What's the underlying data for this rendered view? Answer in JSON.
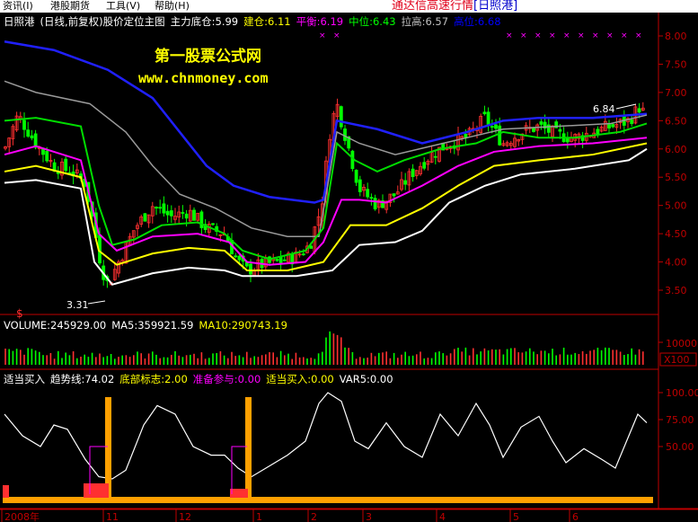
{
  "menu": {
    "items": [
      "资讯(I)",
      "港股期货",
      "工具(V)",
      "帮助(H)"
    ],
    "title": "通达信高速行情",
    "stock_bracket": "[日照港]"
  },
  "header": {
    "stock": "日照港",
    "period": "(日线,前复权)",
    "formula": "股价定位主图",
    "fields": [
      {
        "label": "主力底仓:",
        "value": "5.99",
        "color": "#ffffff"
      },
      {
        "label": "建仓:",
        "value": "6.11",
        "color": "#ffff00"
      },
      {
        "label": "平衡:",
        "value": "6.19",
        "color": "#ff00ff"
      },
      {
        "label": "中位:",
        "value": "6.43",
        "color": "#00ff00"
      },
      {
        "label": "拉高:",
        "value": "6.57",
        "color": "#c0c0c0"
      },
      {
        "label": "高位:",
        "value": "6.68",
        "color": "#0000ff"
      }
    ]
  },
  "watermark": {
    "line1": "第一股票公式网",
    "line2": "www.chnmoney.com"
  },
  "annotations": {
    "high": "6.84",
    "low": "3.31",
    "signal": "$"
  },
  "price_axis": [
    "8.00",
    "7.50",
    "7.00",
    "6.50",
    "6.00",
    "5.50",
    "5.00",
    "4.50",
    "4.00",
    "3.50"
  ],
  "volume": {
    "label": "VOLUME:245929.00",
    "ma5": "MA5:359921.59",
    "ma10": "MA10:290743.19",
    "axis": "10000",
    "unit": "X100"
  },
  "indicator": {
    "title": "适当买入",
    "fields": [
      {
        "label": "趋势线:",
        "value": "74.02",
        "color": "#ffffff"
      },
      {
        "label": "底部标志:",
        "value": "2.00",
        "color": "#ffff00"
      },
      {
        "label": "准备参与:",
        "value": "0.00",
        "color": "#ff00ff"
      },
      {
        "label": "适当买入:",
        "value": "0.00",
        "color": "#ffff00"
      },
      {
        "label": "VAR5:",
        "value": "0.00",
        "color": "#ffffff"
      }
    ],
    "axis": [
      "100.00",
      "75.00",
      "50.00"
    ]
  },
  "dates": [
    "2008年",
    "11",
    "12",
    "1",
    "2",
    "3",
    "4",
    "5",
    "6"
  ],
  "colors": {
    "up": "#ff3030",
    "down": "#00ff00",
    "blue": "#2020ff",
    "gray": "#9a9a9a",
    "green": "#00dd00",
    "magenta": "#ff00ff",
    "yellow": "#ffff00",
    "white": "#ffffff",
    "orange": "#ffa000",
    "axis": "#c00000"
  }
}
